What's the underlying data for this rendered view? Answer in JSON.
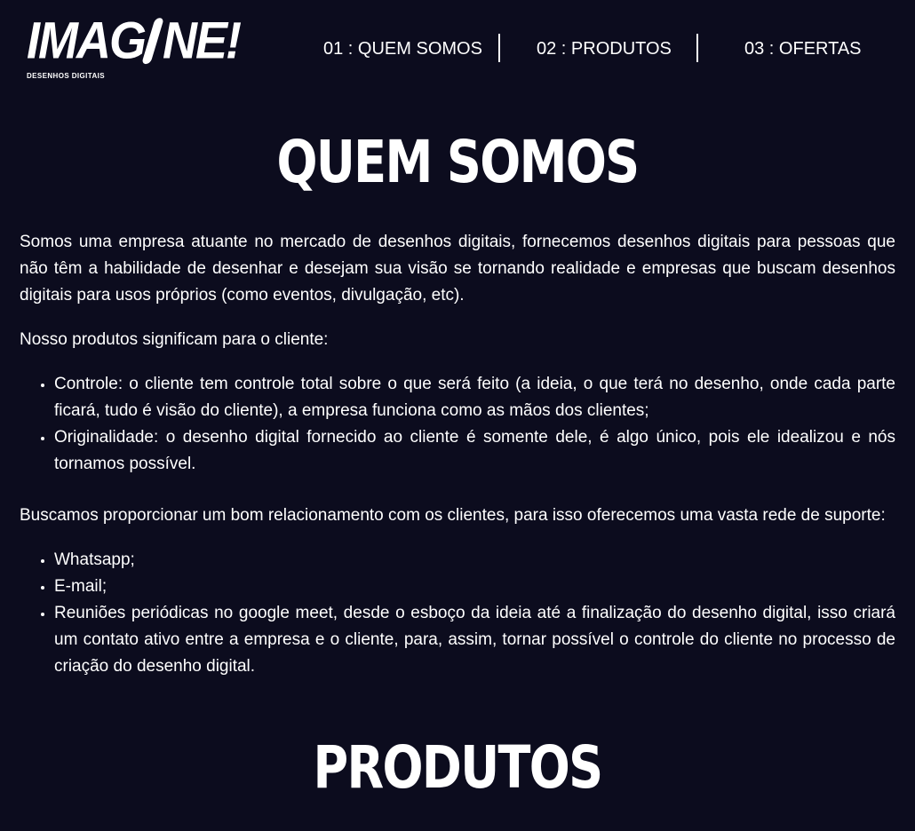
{
  "logo": {
    "word_left": "IMAG",
    "word_right": "NE!",
    "tagline": "DESENHOS DIGITAIS"
  },
  "nav": {
    "items": [
      {
        "label": "01 : QUEM SOMOS"
      },
      {
        "label": "02 : PRODUTOS"
      },
      {
        "label": "03 : OFERTAS"
      }
    ]
  },
  "quem_somos": {
    "title": "QUEM SOMOS",
    "intro": "Somos uma empresa atuante no mercado de desenhos digitais, fornecemos desenhos digitais para pessoas que não têm a habilidade de desenhar e desejam sua visão se tornando realidade e empresas que buscam desenhos digitais para usos próprios (como eventos, divulgação, etc).",
    "products_intro": "Nosso produtos significam para o cliente:",
    "products": [
      "Controle: o cliente tem controle total sobre o que será feito (a ideia, o que terá no desenho, onde cada parte ficará, tudo é visão do cliente), a empresa funciona como as mãos dos clientes;",
      "Originalidade: o desenho digital fornecido ao cliente é somente dele, é algo único, pois ele idealizou e nós tornamos possível."
    ],
    "support_intro": "Buscamos proporcionar um bom relacionamento com os clientes, para isso oferecemos uma vasta rede de suporte:",
    "support": [
      "Whatsapp;",
      "E-mail;",
      "Reuniões periódicas no google meet, desde o esboço da ideia até a finalização do desenho digital, isso criará um contato ativo entre a empresa e o cliente, para, assim, tornar possível o controle do cliente no processo de criação do desenho digital."
    ]
  },
  "produtos": {
    "title": "PRODUTOS"
  }
}
